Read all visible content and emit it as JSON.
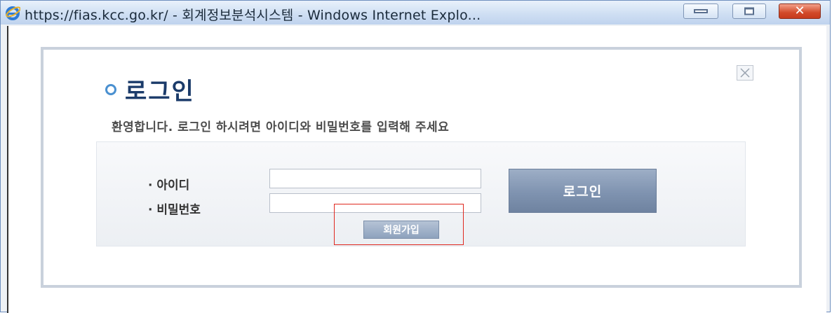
{
  "window": {
    "title": "https://fias.kcc.go.kr/ - 회계정보분석시스템 - Windows Internet Explo...",
    "close_glyph": "✕"
  },
  "dialog": {
    "heading": "로그인",
    "welcome": "환영합니다. 로그인 하시려면 아이디와 비밀번호를 입력해 주세요",
    "id_label": "· 아이디",
    "id_value": "",
    "password_label": "· 비밀번호",
    "password_value": "",
    "login_button": "로그인",
    "signup_button": "회원가입"
  },
  "colors": {
    "accent_dark_blue": "#1b3b6a",
    "login_button": "#7f93b0",
    "highlight": "#e0281f"
  },
  "icons": [
    "ie-logo-icon",
    "minimize-icon",
    "maximize-icon",
    "close-icon",
    "bullet-ring-icon",
    "dialog-close-icon"
  ]
}
